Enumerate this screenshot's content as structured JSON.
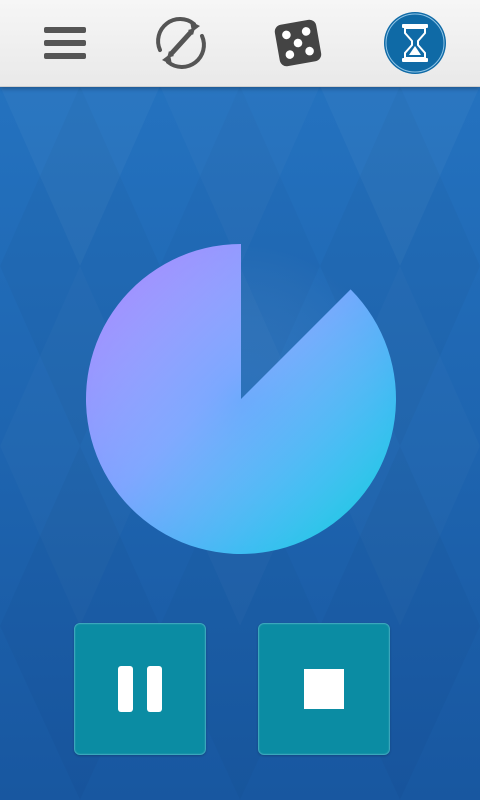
{
  "toolbar": {
    "items": [
      {
        "icon": "menu-icon",
        "active": false
      },
      {
        "icon": "rotate-arrows-icon",
        "active": false
      },
      {
        "icon": "dice-icon",
        "active": false
      },
      {
        "icon": "hourglass-icon",
        "active": true
      }
    ],
    "active_color": "#0f6aa6",
    "icon_color": "#555555"
  },
  "timer": {
    "elapsed_fraction": 0.125,
    "remaining_fraction": 0.875,
    "colors": {
      "purple": "#a98cf5",
      "teal": "#00c8c8",
      "blue": "#45a8ff"
    }
  },
  "controls": {
    "pause_icon": "pause-icon",
    "stop_icon": "stop-icon",
    "button_color": "#0b8ca3"
  }
}
